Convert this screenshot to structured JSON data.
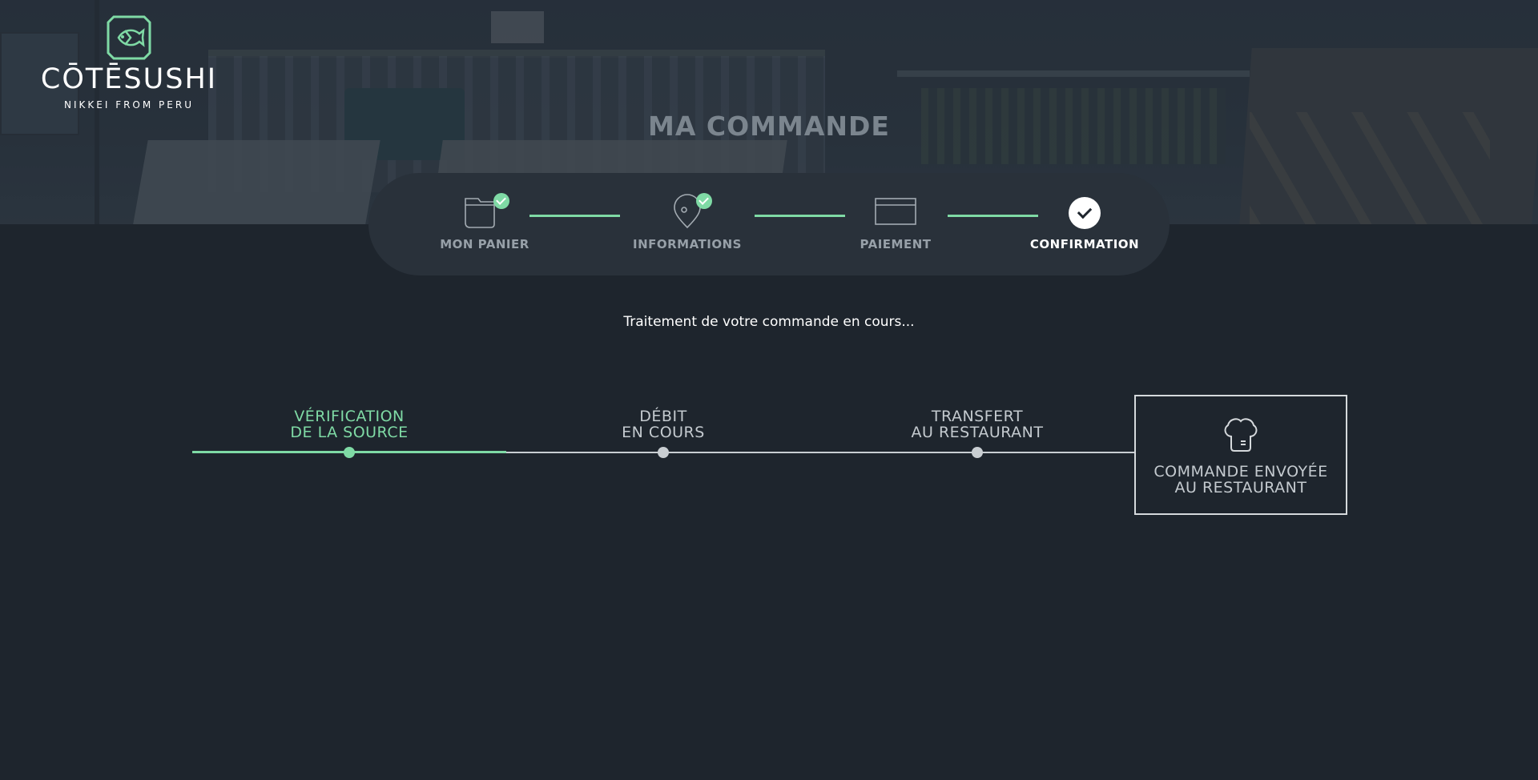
{
  "brand": {
    "name": "CŌTĒSUSHI",
    "tagline": "NIKKEI FROM PERU",
    "logo_icon": "fish-logo-icon",
    "accent_color": "#7fdaa5"
  },
  "page": {
    "title": "MA COMMANDE"
  },
  "stepper": {
    "steps": [
      {
        "label": "MON PANIER",
        "icon": "basket-icon",
        "state": "completed"
      },
      {
        "label": "INFORMATIONS",
        "icon": "location-pin-icon",
        "state": "completed"
      },
      {
        "label": "PAIEMENT",
        "icon": "credit-card-icon",
        "state": "completed"
      },
      {
        "label": "CONFIRMATION",
        "icon": "check-circle-icon",
        "state": "current"
      }
    ]
  },
  "status": {
    "message": "Traitement de votre commande en cours..."
  },
  "progress": {
    "stages": [
      {
        "line1": "VÉRIFICATION",
        "line2": "DE LA SOURCE",
        "state": "done"
      },
      {
        "line1": "DÉBIT",
        "line2": "EN COURS",
        "state": "pending"
      },
      {
        "line1": "TRANSFERT",
        "line2": "AU RESTAURANT",
        "state": "pending"
      }
    ],
    "final": {
      "line1": "COMMANDE ENVOYÉE",
      "line2": "AU RESTAURANT",
      "icon": "chef-hat-icon"
    }
  }
}
